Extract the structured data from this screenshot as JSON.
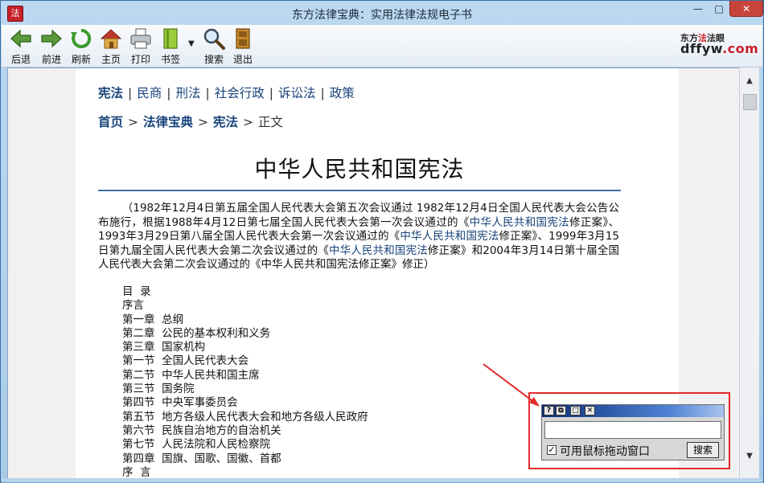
{
  "window": {
    "title": "东方法律宝典：实用法律法规电子书",
    "minimize": "—",
    "maximize": "□",
    "close": "✕"
  },
  "toolbar": {
    "buttons": [
      {
        "label": "后退",
        "icon": "back-arrow-icon"
      },
      {
        "label": "前进",
        "icon": "forward-arrow-icon"
      },
      {
        "label": "刷新",
        "icon": "refresh-icon"
      },
      {
        "label": "主页",
        "icon": "home-icon"
      },
      {
        "label": "打印",
        "icon": "printer-icon"
      },
      {
        "label": "书签",
        "icon": "bookmark-icon"
      },
      {
        "label": "搜索",
        "icon": "magnifier-icon"
      },
      {
        "label": "退出",
        "icon": "exit-door-icon"
      }
    ],
    "bookmark_dropdown": "▼"
  },
  "logo": {
    "top_prefix": "东方",
    "top_accent": "法",
    "top_suffix": "法眼",
    "main_prefix": "dffyw",
    "main_suffix": ".com"
  },
  "content": {
    "nav": [
      "宪法",
      "民商",
      "刑法",
      "社会行政",
      "诉讼法",
      "政策"
    ],
    "nav_separator": "|",
    "breadcrumb": [
      "首页",
      "法律宝典",
      "宪法"
    ],
    "breadcrumb_arrow": ">",
    "breadcrumb_current": "正文",
    "doc_title": "中华人民共和国宪法",
    "preamble": {
      "p1": "（1982年12月4日第五届全国人民代表大会第五次会议通过 1982年12月4日全国人民代表大会公告公布施行，根据1988年4月12日第七届全国人民代表大会第一次会议通过的《",
      "l1": "中华人民共和国宪法",
      "p2": "修正案》、1993年3月29日第八届全国人民代表大会第一次会议通过的《",
      "l2": "中华人民共和国宪法",
      "p3": "修正案》、1999年3月15日第九届全国人民代表大会第二次会议通过的《",
      "l3": "中华人民共和国宪法",
      "p4": "修正案》和2004年3月14日第十届全国人民代表大会第二次会议通过的《中华人民共和国宪法修正案》修正）"
    },
    "toc": [
      "目  录",
      "序言",
      "第一章  总纲",
      "第二章  公民的基本权利和义务",
      "第三章  国家机构",
      "第一节  全国人民代表大会",
      "第二节  中华人民共和国主席",
      "第三节  国务院",
      "第四节  中央军事委员会",
      "第五节  地方各级人民代表大会和地方各级人民政府",
      "第六节  民族自治地方的自治机关",
      "第七节  人民法院和人民检察院",
      "第四章  国旗、国歌、国徽、首都",
      "序  言"
    ]
  },
  "scrollbar": {
    "up": "▲",
    "down": "▼"
  },
  "search_widget": {
    "buttons": [
      "?",
      "⧉",
      "□",
      "✕"
    ],
    "input_value": "",
    "checkbox_checked": "✓",
    "checkbox_label": "可用鼠标拖动窗口",
    "search_button": "搜索"
  },
  "colors": {
    "link": "#17437a",
    "annotation": "#e32a2a",
    "title_rule": "#3d6da8"
  }
}
